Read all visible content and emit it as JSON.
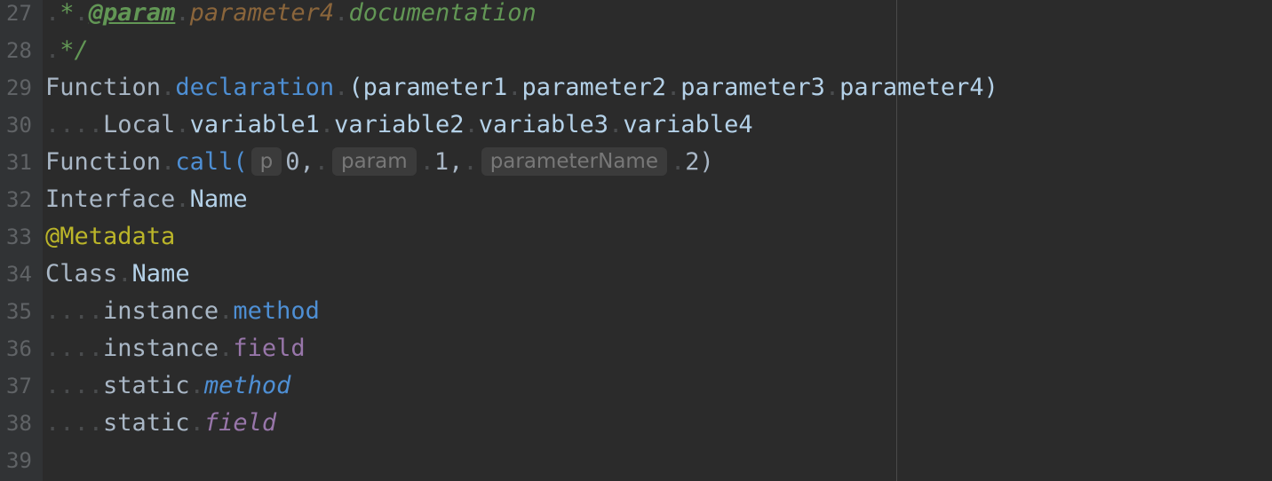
{
  "editor": {
    "lines": [
      {
        "num": "27"
      },
      {
        "num": "28"
      },
      {
        "num": "29"
      },
      {
        "num": "30"
      },
      {
        "num": "31"
      },
      {
        "num": "32"
      },
      {
        "num": "33"
      },
      {
        "num": "34"
      },
      {
        "num": "35"
      },
      {
        "num": "36"
      },
      {
        "num": "37"
      },
      {
        "num": "38"
      },
      {
        "num": "39"
      }
    ]
  },
  "code": {
    "l27": {
      "star": "*",
      "tag": "@param",
      "param": "parameter4",
      "doc": "documentation"
    },
    "l28": {
      "end": "*/"
    },
    "l29": {
      "kw": "Function",
      "name": "declaration",
      "args": "(parameter1",
      "p2": "parameter2",
      "p3": "parameter3",
      "p4": "parameter4)"
    },
    "l30": {
      "kw": "Local",
      "v1": "variable1",
      "v2": "variable2",
      "v3": "variable3",
      "v4": "variable4"
    },
    "l31": {
      "kw": "Function",
      "name": "call(",
      "hint1": "p",
      "a1": "0,",
      "hint2": "param",
      "a2": "1,",
      "hint3": "parameterName",
      "a3": "2)"
    },
    "l32": {
      "kw": "Interface",
      "name": "Name"
    },
    "l33": {
      "meta": "@Metadata"
    },
    "l34": {
      "kw": "Class",
      "name": "Name"
    },
    "l35": {
      "kw": "instance",
      "member": "method"
    },
    "l36": {
      "kw": "instance",
      "member": "field"
    },
    "l37": {
      "kw": "static",
      "member": "method"
    },
    "l38": {
      "kw": "static",
      "member": "field"
    }
  },
  "colors": {
    "background": "#2b2b2b",
    "gutter": "#313335",
    "line_number": "#606366",
    "doc_comment": "#629755",
    "doc_param": "#8a653b",
    "function": "#4e8fd4",
    "field": "#9876aa",
    "metadata": "#bbb529",
    "text": "#a9b7c6"
  }
}
